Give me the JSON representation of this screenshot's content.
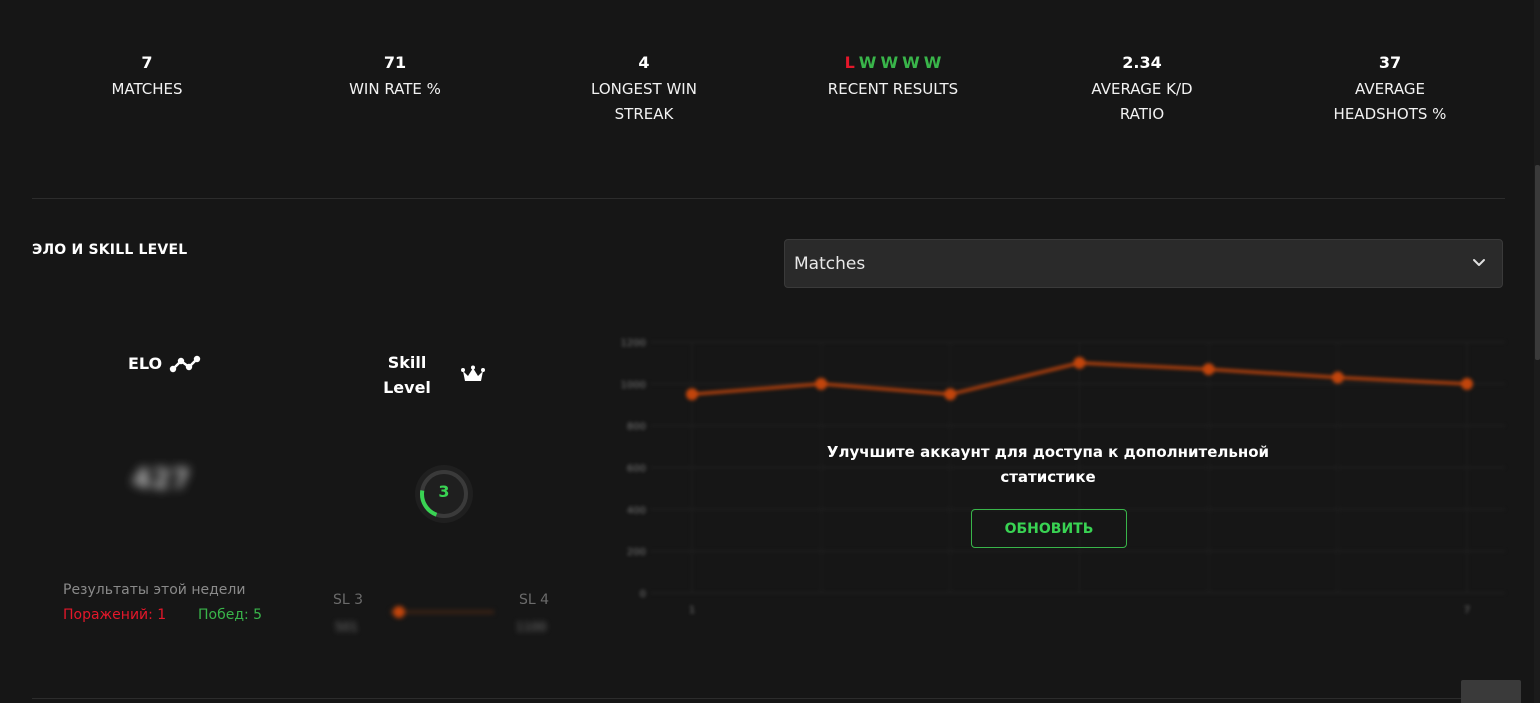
{
  "stats": [
    {
      "value": "7",
      "label": "MATCHES"
    },
    {
      "value": "71",
      "label": "WIN RATE %"
    },
    {
      "value": "4",
      "label": "LONGEST WIN STREAK"
    },
    {
      "value": "",
      "label": "RECENT RESULTS"
    },
    {
      "value": "2.34",
      "label": "AVERAGE K/D RATIO"
    },
    {
      "value": "37",
      "label": "AVERAGE HEADSHOTS %"
    }
  ],
  "recent_results": [
    "L",
    "W",
    "W",
    "W",
    "W"
  ],
  "colors": {
    "loss": "#e4172a",
    "win": "#39b54a",
    "accent": "#39d353",
    "chart_line": "#c2450c"
  },
  "section": {
    "title": "ЭЛО И SKILL LEVEL"
  },
  "dropdown": {
    "selected": "Matches"
  },
  "elo": {
    "label": "ELO",
    "value": "427",
    "icon": "elo-graph-icon"
  },
  "skill": {
    "label": "Skill Level",
    "value": "3",
    "icon": "crown-icon",
    "progress": 0.4
  },
  "week": {
    "title": "Результаты этой недели",
    "losses": "Поражений: 1",
    "wins": "Побед: 5"
  },
  "sl_progress": {
    "current": "SL 3",
    "next": "SL 4",
    "current_elo": "501",
    "next_elo": "1100"
  },
  "chart_data": {
    "type": "line",
    "x": [
      1,
      2,
      3,
      4,
      5,
      6,
      7
    ],
    "series": [
      {
        "values": [
          950,
          1000,
          950,
          1100,
          1070,
          1030,
          1000
        ]
      }
    ],
    "y_ticks": [
      "0",
      "200",
      "400",
      "600",
      "800",
      "1000",
      "1200"
    ],
    "x_tick_labels": [
      "1",
      "7"
    ],
    "ylim": [
      0,
      1200
    ],
    "grid": true,
    "blurred": true
  },
  "upgrade": {
    "text": "Улучшите аккаунт для доступа к дополнительной статистике",
    "button": "ОБНОВИТЬ"
  }
}
